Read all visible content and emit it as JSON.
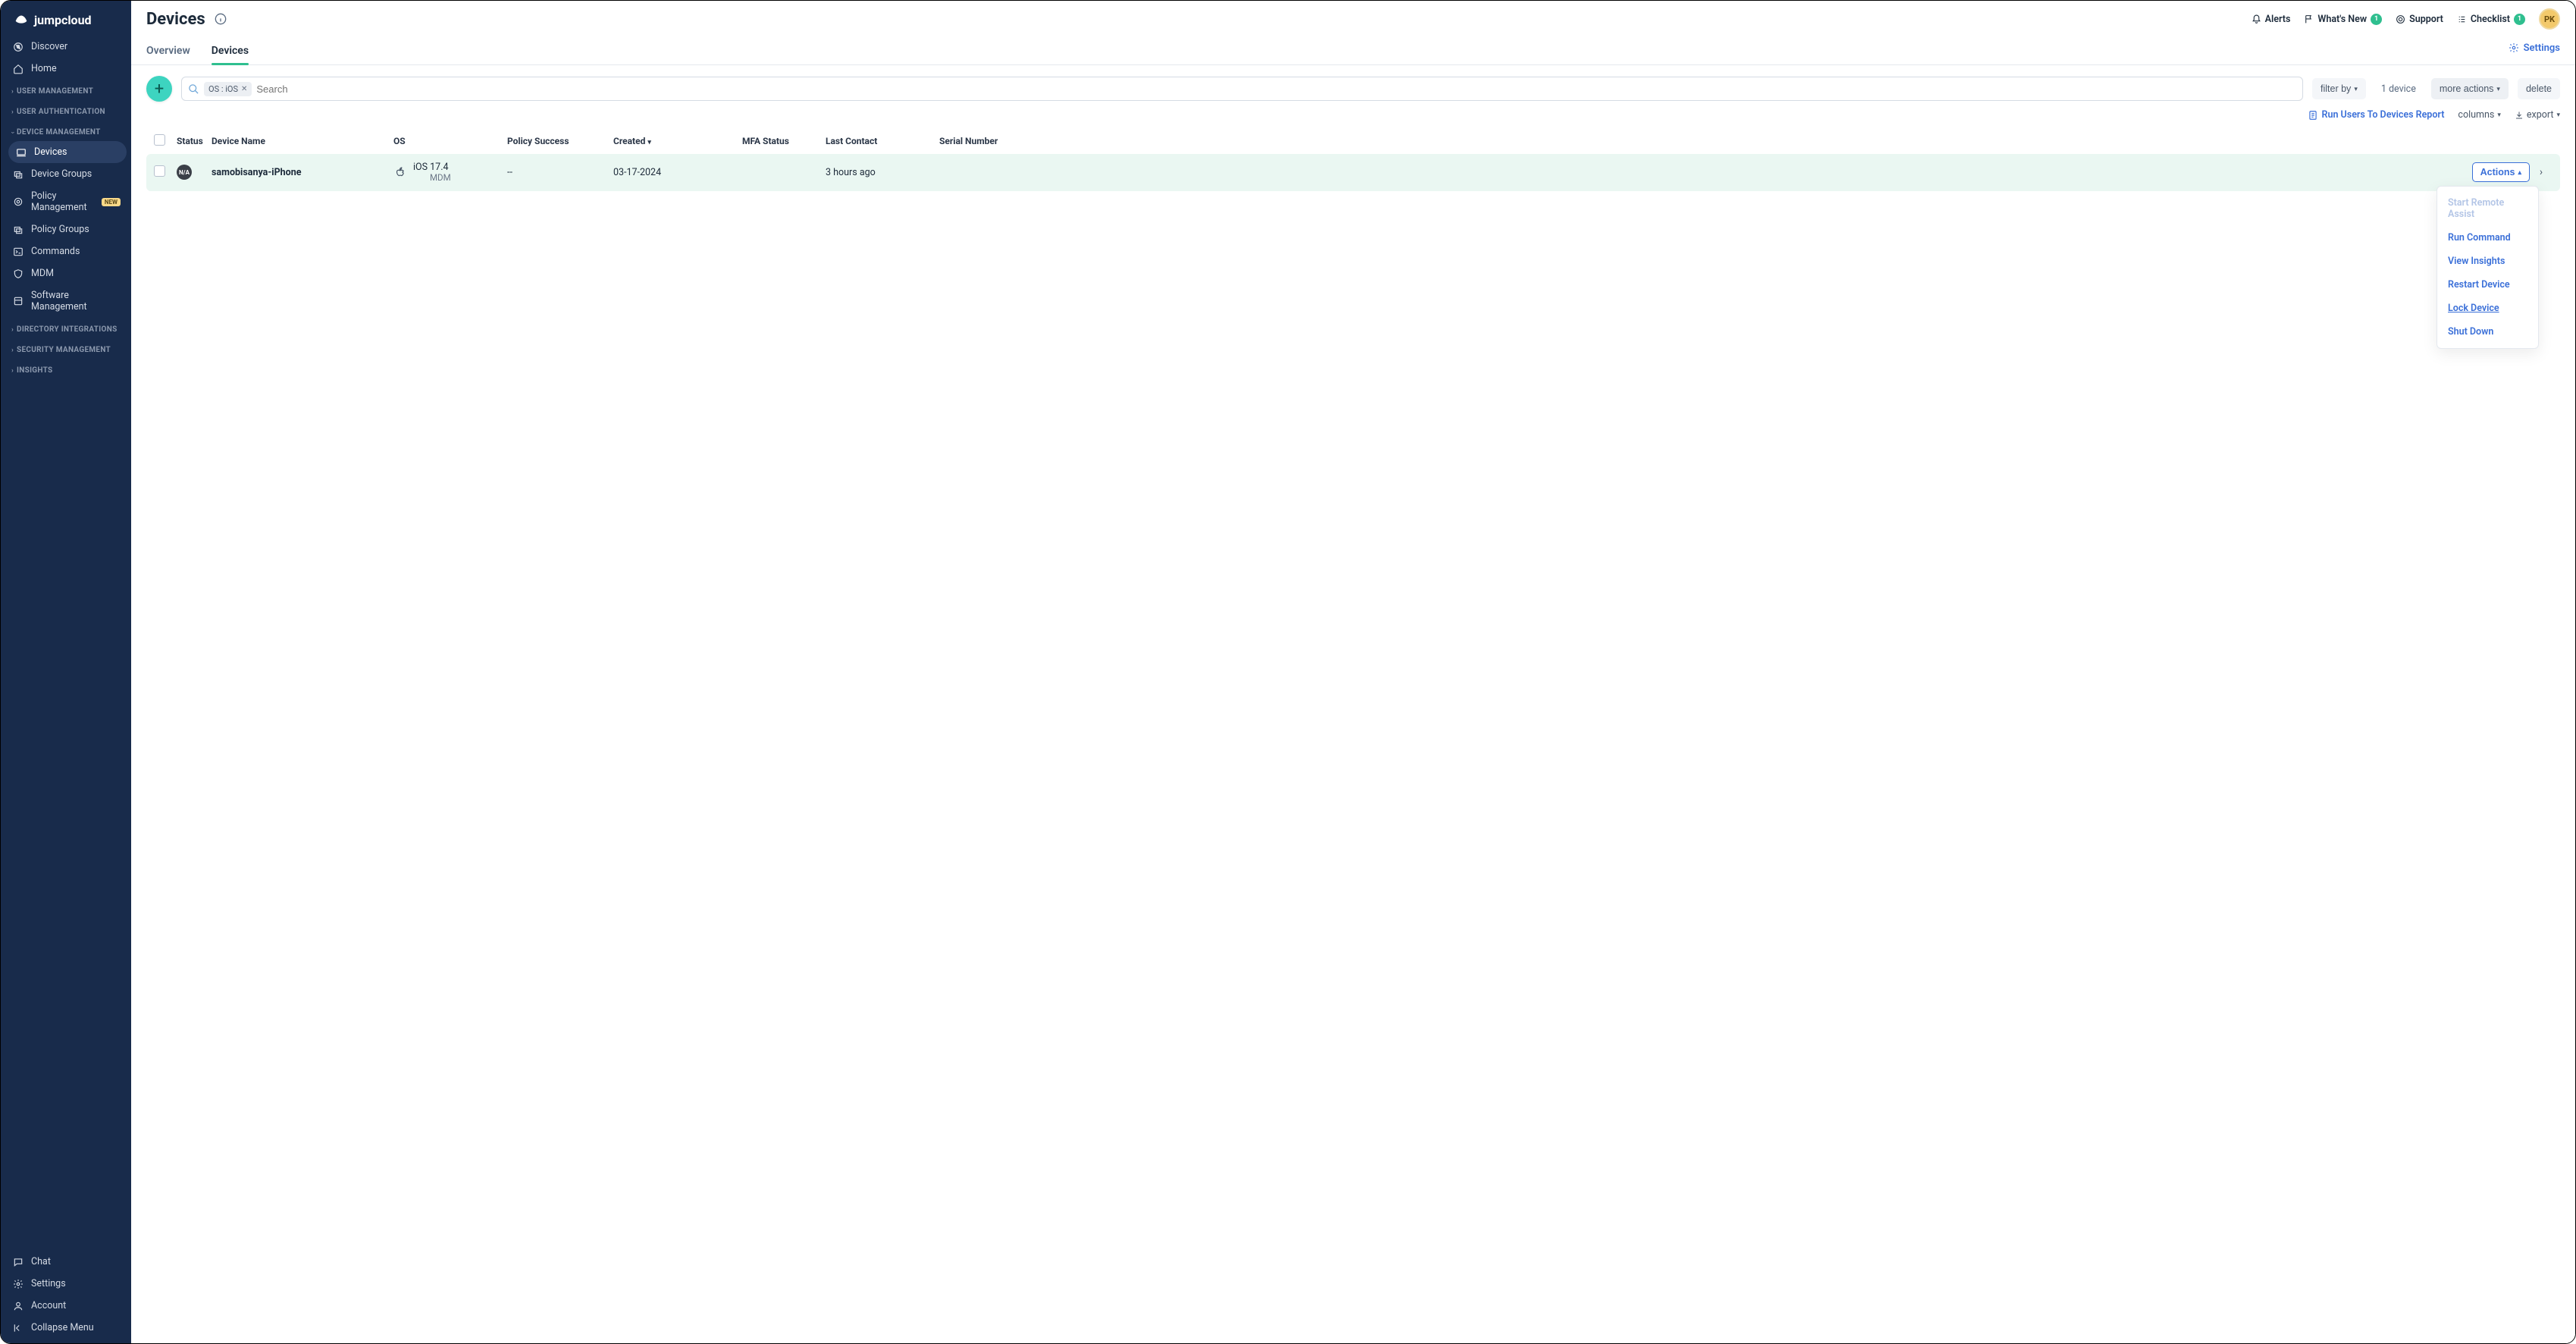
{
  "brand": "jumpcloud",
  "header": {
    "title": "Devices",
    "links": {
      "alerts": "Alerts",
      "whatsnew": "What's New",
      "whatsnew_count": "1",
      "support": "Support",
      "checklist": "Checklist",
      "checklist_count": "1"
    },
    "avatar": "PK"
  },
  "tabs": {
    "overview": "Overview",
    "devices": "Devices",
    "settings": "Settings"
  },
  "sidebar": {
    "top": [
      {
        "label": "Discover",
        "icon": "compass"
      },
      {
        "label": "Home",
        "icon": "home"
      }
    ],
    "sections": [
      {
        "title": "USER MANAGEMENT",
        "expanded": false
      },
      {
        "title": "USER AUTHENTICATION",
        "expanded": false
      },
      {
        "title": "DEVICE MANAGEMENT",
        "expanded": true,
        "items": [
          {
            "label": "Devices",
            "icon": "laptop",
            "active": true
          },
          {
            "label": "Device Groups",
            "icon": "layers"
          },
          {
            "label": "Policy Management",
            "icon": "target",
            "badge": "NEW"
          },
          {
            "label": "Policy Groups",
            "icon": "layers"
          },
          {
            "label": "Commands",
            "icon": "terminal"
          },
          {
            "label": "MDM",
            "icon": "shield"
          },
          {
            "label": "Software Management",
            "icon": "package"
          }
        ]
      },
      {
        "title": "DIRECTORY INTEGRATIONS",
        "expanded": false
      },
      {
        "title": "SECURITY MANAGEMENT",
        "expanded": false
      },
      {
        "title": "INSIGHTS",
        "expanded": false
      }
    ],
    "bottom": [
      {
        "label": "Chat",
        "icon": "chat"
      },
      {
        "label": "Settings",
        "icon": "gear"
      },
      {
        "label": "Account",
        "icon": "user"
      },
      {
        "label": "Collapse Menu",
        "icon": "collapse"
      }
    ]
  },
  "toolbar": {
    "chip": "OS : iOS",
    "search_placeholder": "Search",
    "filter": "filter by",
    "device_count": "1 device",
    "more_actions": "more actions",
    "delete": "delete"
  },
  "subbar": {
    "report": "Run Users To Devices Report",
    "columns": "columns",
    "export": "export"
  },
  "table": {
    "headers": {
      "status": "Status",
      "name": "Device Name",
      "os": "OS",
      "policy": "Policy Success",
      "created": "Created",
      "mfa": "MFA Status",
      "last": "Last Contact",
      "serial": "Serial Number"
    },
    "row": {
      "status_badge": "N/A",
      "name": "samobisanya-iPhone",
      "os_line1": "iOS 17.4",
      "os_line2": "MDM",
      "policy": "--",
      "created": "03-17-2024",
      "mfa": "",
      "last": "3 hours ago",
      "serial": "",
      "actions": "Actions"
    }
  },
  "dropdown": {
    "start_remote": "Start Remote Assist",
    "run_command": "Run Command",
    "view_insights": "View Insights",
    "restart": "Restart Device",
    "lock": "Lock Device",
    "shutdown": "Shut Down"
  }
}
